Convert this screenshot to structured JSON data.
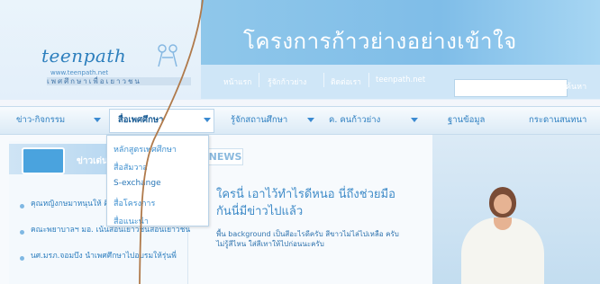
{
  "header": {
    "logo_text": "teenpath",
    "logo_url_text": "www.teenpath.net",
    "logo_tagline": "เพศศึกษาเพื่อเยาวชน",
    "banner_title": "โครงการก้าวย่างอย่างเข้าใจ"
  },
  "top_links": [
    {
      "label": "หน้าแรก"
    },
    {
      "label": "รู้จักก้าวย่าง"
    },
    {
      "label": "ติดต่อเรา"
    },
    {
      "label": "teenpath.net"
    }
  ],
  "search": {
    "button_label": "ค้นหา",
    "placeholder": ""
  },
  "nav": [
    {
      "label": "ข่าว-กิจกรรม"
    },
    {
      "label": "สื่อเพศศึกษา"
    },
    {
      "label": "รู้จักสถานศึกษา"
    },
    {
      "label": "ค. คนก้าวย่าง"
    },
    {
      "label": "ฐานข้อมูล"
    },
    {
      "label": "กระดานสนทนา"
    }
  ],
  "dropdown": [
    {
      "label": "หลักสูตรเพศศึกษา"
    },
    {
      "label": "สื่อสัมวาส"
    },
    {
      "label": "S-exchange"
    },
    {
      "label": "สื่อโครงการ"
    },
    {
      "label": "สื่อแนะนำ"
    }
  ],
  "left_panel": {
    "title": "ข่าวเด่น",
    "items": [
      {
        "text": "คุณหญิงกษมาหนุนให้ ศึกษาเรื่องเพศ"
      },
      {
        "text": "คณะพยาบาลฯ มอ. เน้นสอนเยาวชนสอนเยาวชน"
      },
      {
        "text": "นศ.มรภ.จอมบึง นำเพศศึกษาไปอบรมให้รุ่นพี่"
      }
    ]
  },
  "middle": {
    "tag": "NEWS",
    "headline": "ใครนี่ เอาไว้ทำไรดีหนอ นี่ถึงช่วยมือกันนี่มีข่าวไปแล้ว",
    "body": "พื้น background เป็นสีอะไรดีครับ สีขาวไม่ไล่ไปเหลือ ครับ ไม่รู้สีไหน ใส่สีเทาให้ไปก่อนนะครับ"
  }
}
